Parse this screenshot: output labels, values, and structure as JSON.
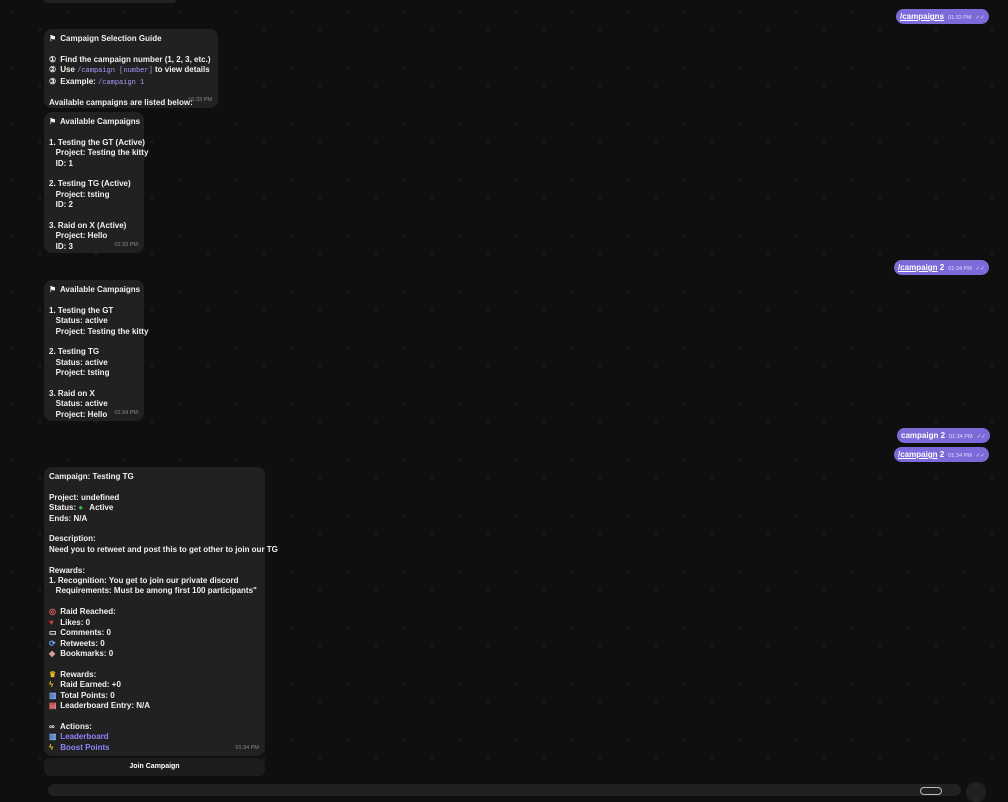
{
  "outgoing": [
    {
      "cmd": "/campaigns",
      "rest": "",
      "time": "01:33 PM"
    },
    {
      "cmd": "/campaign",
      "rest": " 2",
      "time": "01:34 PM"
    },
    {
      "cmd": "",
      "rest": "campaign 2",
      "time": "01:34 PM"
    },
    {
      "cmd": "/campaign",
      "rest": " 2",
      "time": "01:34 PM"
    }
  ],
  "guide": {
    "title": "Campaign Selection Guide",
    "step1": "Find the campaign number (1, 2, 3, etc.)",
    "step2_pre": "Use",
    "step2_code": "/campaign [number]",
    "step2_post": "to view details",
    "step3_pre": "Example:",
    "step3_code": "/campaign 1",
    "footer": "Available campaigns are listed below:",
    "time": "01:33 PM"
  },
  "list1": {
    "title": "Available Campaigns",
    "lines": [
      "1. Testing the GT (Active)",
      "   Project: Testing the kitty",
      "   ID: 1",
      "",
      "2. Testing TG (Active)",
      "   Project: tsting",
      "   ID: 2",
      "",
      "3. Raid on X (Active)",
      "   Project: Hello",
      "   ID: 3"
    ],
    "time": "01:33 PM"
  },
  "list2": {
    "title": "Available Campaigns",
    "lines": [
      "1. Testing the GT",
      "   Status: active",
      "   Project: Testing the kitty",
      "",
      "2. Testing TG",
      "   Status: active",
      "   Project: tsting",
      "",
      "3. Raid on X",
      "   Status: active",
      "   Project: Hello"
    ],
    "time": "01:34 PM"
  },
  "detail": {
    "title": "Campaign: Testing TG",
    "project": "Project: undefined",
    "status_label": "Status:",
    "status_value": "Active",
    "ends": "Ends: N/A",
    "desc_label": "Description:",
    "desc": "Need you to retweet and post this to get other to join our TG",
    "rewards_label": "Rewards:",
    "reward1": "1. Recognition: You get to join our private discord",
    "reward1_req": "   Requirements: Must be among first 100 participants\"",
    "raid_label": "Raid Reached:",
    "likes": "Likes: 0",
    "comments": "Comments: 0",
    "retweets": "Retweets: 0",
    "bookmarks": "Bookmarks: 0",
    "rewards2_label": "Rewards:",
    "raid_earned": "Raid Earned: +0",
    "total_points": "Total Points: 0",
    "leaderboard_entry": "Leaderboard Entry: N/A",
    "actions_label": "Actions:",
    "leaderboard_link": "Leaderboard",
    "boost_link": "Boost Points",
    "time": "01:34 PM",
    "join_button": "Join Campaign"
  },
  "colors": {
    "accent": "#7b6ad8",
    "bubble": "#212121",
    "link": "#8e83ff",
    "background": "#0f0f0f"
  }
}
